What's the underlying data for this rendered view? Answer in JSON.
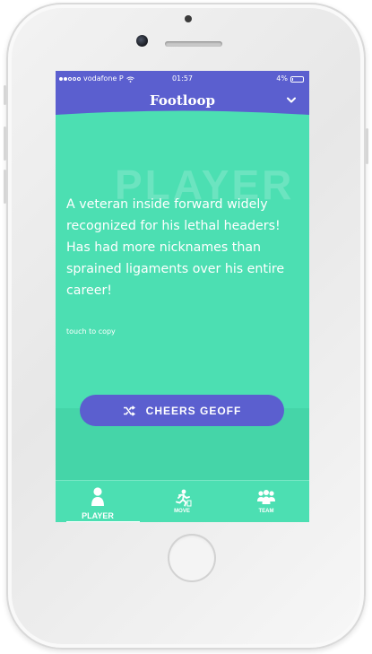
{
  "status_bar": {
    "carrier": "vodafone P",
    "time": "01:57",
    "battery": "4%"
  },
  "header": {
    "title": "Footloop",
    "menu_icon": "chevron-down-icon"
  },
  "content": {
    "watermark": "PLAYER",
    "description": "A veteran inside forward widely recognized for his lethal headers! Has had more nicknames than sprained ligaments over his entire career!",
    "copy_hint": "touch to copy"
  },
  "cta": {
    "label": "CHEERS GEOFF",
    "icon": "shuffle-icon"
  },
  "tabs": [
    {
      "label": "PLAYER",
      "icon": "person-icon",
      "active": true
    },
    {
      "label": "MOVE",
      "icon": "runner-icon",
      "active": false
    },
    {
      "label": "TEAM",
      "icon": "group-icon",
      "active": false
    }
  ],
  "colors": {
    "primary": "#5b5fcf",
    "accent": "#4cdfb2",
    "text": "#ffffff"
  }
}
